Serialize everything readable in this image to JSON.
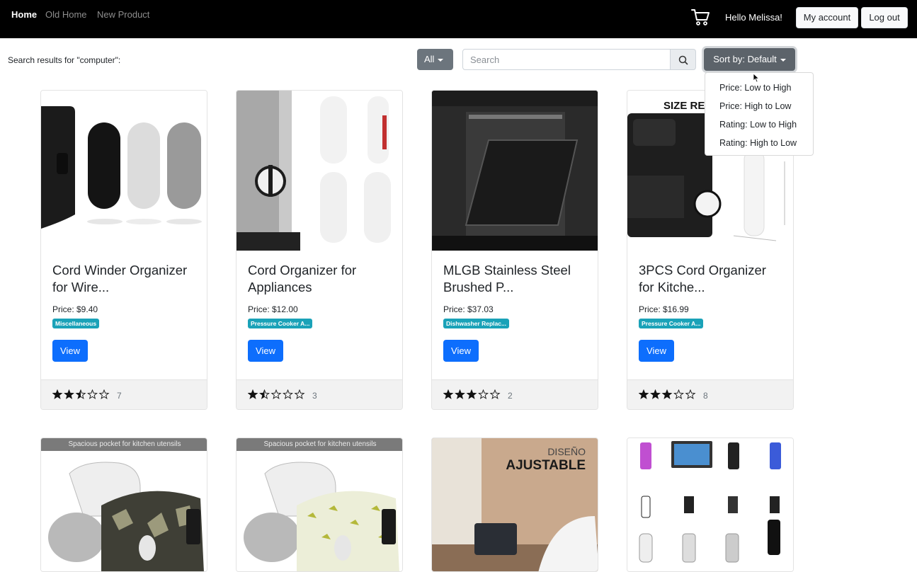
{
  "nav": {
    "links": [
      "Home",
      "Old Home",
      "New Product"
    ],
    "greeting": "Hello Melissa!",
    "account_label": "My account",
    "logout_label": "Log out"
  },
  "search": {
    "results_label": "Search results for \"computer\":",
    "category_label": "All",
    "placeholder": "Search",
    "sort_label": "Sort by: Default",
    "sort_options": [
      "Price: Low to High",
      "Price: High to Low",
      "Rating: Low to High",
      "Rating: High to Low"
    ]
  },
  "products": [
    {
      "title": "Cord Winder Organizer for Wire...",
      "price": "Price: $9.40",
      "category": "Miscellaneous",
      "rating": 2.5,
      "reviews": "7"
    },
    {
      "title": "Cord Organizer for Appliances",
      "price": "Price: $12.00",
      "category": "Pressure Cooker A...",
      "rating": 1.5,
      "reviews": "3"
    },
    {
      "title": "MLGB Stainless Steel Brushed P...",
      "price": "Price: $37.03",
      "category": "Dishwasher Replac...",
      "rating": 3,
      "reviews": "2"
    },
    {
      "title": "3PCS Cord Organizer for Kitche...",
      "price": "Price: $16.99",
      "category": "Pressure Cooker A...",
      "rating": 3,
      "reviews": "8"
    }
  ],
  "product_images": {
    "size_text": "SIZE RE",
    "pocket_banner": "Spacious pocket for kitchen utensils",
    "diseno": "DISEÑO",
    "ajustable": "AJUSTABLE"
  },
  "view_label": "View",
  "colors": {
    "navbar": "#000000",
    "primary": "#0d6efd",
    "badge": "#1aa2b8",
    "secondary": "#6c757d"
  },
  "icons": {
    "cart": "cart-icon",
    "search": "search-icon",
    "star": "star-icon"
  }
}
